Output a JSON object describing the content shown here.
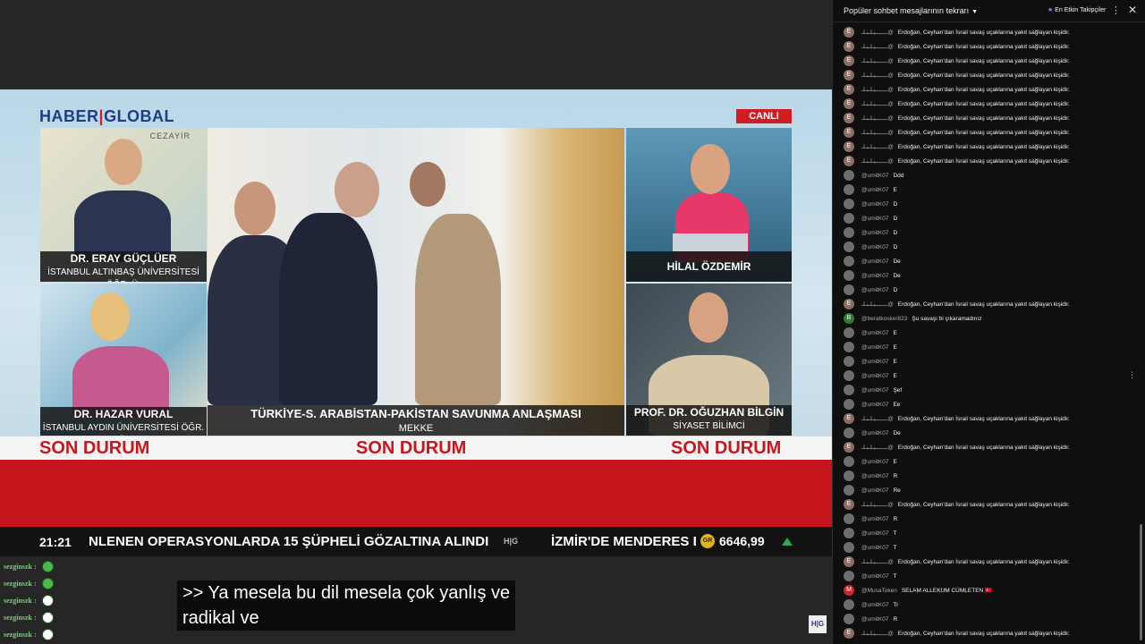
{
  "broadcast": {
    "logo_left": "HABER",
    "logo_right": "GLOBAL",
    "live_badge": "CANLI",
    "map_label": "CEZAYİR",
    "panels": [
      {
        "name": "DR. ERAY GÜÇLÜER",
        "subtitle": "İSTANBUL ALTINBAŞ ÜNİVERSİTESİ ÖĞR. Ü."
      },
      {
        "name": "DR. HAZAR VURAL",
        "subtitle": "İSTANBUL AYDIN ÜNİVERSİTESİ ÖĞR. Ü."
      },
      {
        "name": "TÜRKİYE-S. ARABİSTAN-PAKİSTAN SAVUNMA ANLAŞMASI",
        "subtitle": "MEKKE"
      },
      {
        "name": "HİLAL ÖZDEMİR",
        "subtitle": ""
      },
      {
        "name": "PROF. DR. OĞUZHAN BİLGİN",
        "subtitle": "SİYASET BİLİMCİ"
      }
    ],
    "banner_text": "SON DURUM",
    "ticker": {
      "time": "21:21",
      "headline": "NLENEN OPERASYONLARDA 15 ŞÜPHELİ GÖZALTINA ALINDI",
      "separator_logo": "H|G",
      "headline2": "İZMİR'DE MENDERES B",
      "gold_icon": "gold-coin-icon",
      "gold_label": "GR",
      "gold_price": "6646,99",
      "trend": "up"
    },
    "subtitle_lines": [
      ">> Ya mesela bu dil mesela çok yanlış ve",
      "radikal ve"
    ],
    "corner_logo": "H|G"
  },
  "side_chat": {
    "user": "sezginszk :",
    "rows": 5
  },
  "chat": {
    "header_title": "Popüler sohbet mesajlarının tekrarı",
    "top_label": "En Etkin Takipçiler",
    "messages": [
      {
        "avatar": "E",
        "color": "#8d6e63",
        "author": "ـــــــبـلـبـلـ@",
        "text": "Erdoğan, Ceyhan'dan İsrail savaş uçaklarına yakıt sağlayan kişidir."
      },
      {
        "avatar": "E",
        "color": "#8d6e63",
        "author": "ـــــــبـلـبـلـ@",
        "text": "Erdoğan, Ceyhan'dan İsrail savaş uçaklarına yakıt sağlayan kişidir."
      },
      {
        "avatar": "E",
        "color": "#8d6e63",
        "author": "ـــــــبـلـبـلـ@",
        "text": "Erdoğan, Ceyhan'dan İsrail savaş uçaklarına yakıt sağlayan kişidir."
      },
      {
        "avatar": "E",
        "color": "#8d6e63",
        "author": "ـــــــبـلـبـلـ@",
        "text": "Erdoğan, Ceyhan'dan İsrail savaş uçaklarına yakıt sağlayan kişidir."
      },
      {
        "avatar": "E",
        "color": "#8d6e63",
        "author": "ـــــــبـلـبـلـ@",
        "text": "Erdoğan, Ceyhan'dan İsrail savaş uçaklarına yakıt sağlayan kişidir."
      },
      {
        "avatar": "E",
        "color": "#8d6e63",
        "author": "ـــــــبـلـبـلـ@",
        "text": "Erdoğan, Ceyhan'dan İsrail savaş uçaklarına yakıt sağlayan kişidir."
      },
      {
        "avatar": "E",
        "color": "#8d6e63",
        "author": "ـــــــبـلـبـلـ@",
        "text": "Erdoğan, Ceyhan'dan İsrail savaş uçaklarına yakıt sağlayan kişidir."
      },
      {
        "avatar": "E",
        "color": "#8d6e63",
        "author": "ـــــــبـلـبـلـ@",
        "text": "Erdoğan, Ceyhan'dan İsrail savaş uçaklarına yakıt sağlayan kişidir."
      },
      {
        "avatar": "E",
        "color": "#8d6e63",
        "author": "ـــــــبـلـبـلـ@",
        "text": "Erdoğan, Ceyhan'dan İsrail savaş uçaklarına yakıt sağlayan kişidir."
      },
      {
        "avatar": "E",
        "color": "#8d6e63",
        "author": "ـــــــبـلـبـلـ@",
        "text": "Erdoğan, Ceyhan'dan İsrail savaş uçaklarına yakıt sağlayan kişidir."
      },
      {
        "avatar": "",
        "color": "#6d6d6d",
        "author": "@umitK07",
        "text": "Ddd"
      },
      {
        "avatar": "",
        "color": "#6d6d6d",
        "author": "@umitK07",
        "text": "E"
      },
      {
        "avatar": "",
        "color": "#6d6d6d",
        "author": "@umitK07",
        "text": "D"
      },
      {
        "avatar": "",
        "color": "#6d6d6d",
        "author": "@umitK07",
        "text": "D"
      },
      {
        "avatar": "",
        "color": "#6d6d6d",
        "author": "@umitK07",
        "text": "D"
      },
      {
        "avatar": "",
        "color": "#6d6d6d",
        "author": "@umitK07",
        "text": "D"
      },
      {
        "avatar": "",
        "color": "#6d6d6d",
        "author": "@umitK07",
        "text": "De"
      },
      {
        "avatar": "",
        "color": "#6d6d6d",
        "author": "@umitK07",
        "text": "De"
      },
      {
        "avatar": "",
        "color": "#6d6d6d",
        "author": "@umitK07",
        "text": "D"
      },
      {
        "avatar": "E",
        "color": "#8d6e63",
        "author": "ـــــــبـلـبـلـ@",
        "text": "Erdoğan, Ceyhan'dan İsrail savaş uçaklarına yakıt sağlayan kişidir."
      },
      {
        "avatar": "B",
        "color": "#2e7d32",
        "author": "@beratkosker823",
        "text": "Şu savaşı bi çıkaramadınız"
      },
      {
        "avatar": "",
        "color": "#6d6d6d",
        "author": "@umitK07",
        "text": "E"
      },
      {
        "avatar": "",
        "color": "#6d6d6d",
        "author": "@umitK07",
        "text": "E"
      },
      {
        "avatar": "",
        "color": "#6d6d6d",
        "author": "@umitK07",
        "text": "E"
      },
      {
        "avatar": "",
        "color": "#6d6d6d",
        "author": "@umitK07",
        "text": "E"
      },
      {
        "avatar": "",
        "color": "#6d6d6d",
        "author": "@umitK07",
        "text": "Şef"
      },
      {
        "avatar": "",
        "color": "#6d6d6d",
        "author": "@umitK07",
        "text": "Ee"
      },
      {
        "avatar": "E",
        "color": "#8d6e63",
        "author": "ـــــــبـلـبـلـ@",
        "text": "Erdoğan, Ceyhan'dan İsrail savaş uçaklarına yakıt sağlayan kişidir."
      },
      {
        "avatar": "",
        "color": "#6d6d6d",
        "author": "@umitK07",
        "text": "De"
      },
      {
        "avatar": "E",
        "color": "#8d6e63",
        "author": "ـــــــبـلـبـلـ@",
        "text": "Erdoğan, Ceyhan'dan İsrail savaş uçaklarına yakıt sağlayan kişidir."
      },
      {
        "avatar": "",
        "color": "#6d6d6d",
        "author": "@umitK07",
        "text": "E"
      },
      {
        "avatar": "",
        "color": "#6d6d6d",
        "author": "@umitK07",
        "text": "R"
      },
      {
        "avatar": "",
        "color": "#6d6d6d",
        "author": "@umitK07",
        "text": "Re"
      },
      {
        "avatar": "E",
        "color": "#8d6e63",
        "author": "ـــــــبـلـبـلـ@",
        "text": "Erdoğan, Ceyhan'dan İsrail savaş uçaklarına yakıt sağlayan kişidir."
      },
      {
        "avatar": "",
        "color": "#6d6d6d",
        "author": "@umitK07",
        "text": "R"
      },
      {
        "avatar": "",
        "color": "#6d6d6d",
        "author": "@umitK07",
        "text": "T"
      },
      {
        "avatar": "",
        "color": "#6d6d6d",
        "author": "@umitK07",
        "text": "T"
      },
      {
        "avatar": "E",
        "color": "#8d6e63",
        "author": "ـــــــبـلـبـلـ@",
        "text": "Erdoğan, Ceyhan'dan İsrail savaş uçaklarına yakıt sağlayan kişidir."
      },
      {
        "avatar": "",
        "color": "#6d6d6d",
        "author": "@umitK07",
        "text": "T"
      },
      {
        "avatar": "M",
        "color": "#c62828",
        "author": "@MusaToken",
        "text": "SELAM ALLEKUM CÜMLETEN 🇹🇷"
      },
      {
        "avatar": "",
        "color": "#6d6d6d",
        "author": "@umitK07",
        "text": "Tr"
      },
      {
        "avatar": "",
        "color": "#6d6d6d",
        "author": "@umitK07",
        "text": "R"
      },
      {
        "avatar": "E",
        "color": "#8d6e63",
        "author": "ـــــــبـلـبـلـ@",
        "text": "Erdoğan, Ceyhan'dan İsrail savaş uçaklarına yakıt sağlayan kişidir."
      }
    ]
  }
}
